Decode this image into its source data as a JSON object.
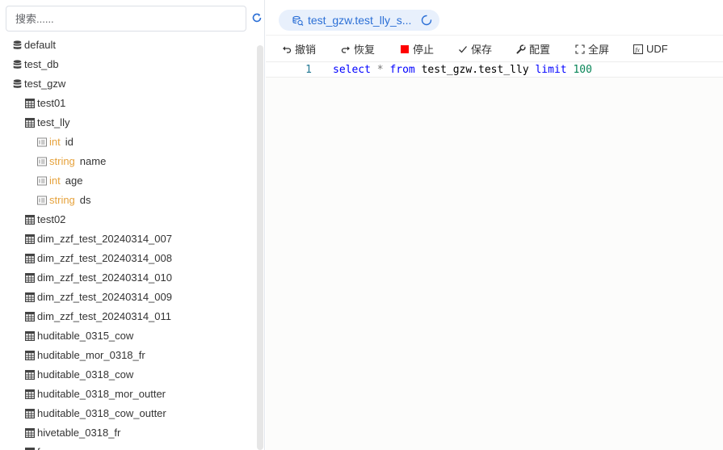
{
  "search": {
    "placeholder": "搜索......"
  },
  "tree": {
    "nodes": [
      {
        "level": 0,
        "kind": "database",
        "label": "default"
      },
      {
        "level": 0,
        "kind": "database",
        "label": "test_db"
      },
      {
        "level": 0,
        "kind": "database",
        "label": "test_gzw"
      },
      {
        "level": 1,
        "kind": "table",
        "label": "test01"
      },
      {
        "level": 1,
        "kind": "table",
        "label": "test_lly"
      },
      {
        "level": 2,
        "kind": "column",
        "type": "int",
        "label": "id"
      },
      {
        "level": 2,
        "kind": "column",
        "type": "string",
        "label": "name"
      },
      {
        "level": 2,
        "kind": "column",
        "type": "int",
        "label": "age"
      },
      {
        "level": 2,
        "kind": "column",
        "type": "string",
        "label": "ds"
      },
      {
        "level": 1,
        "kind": "table",
        "label": "test02"
      },
      {
        "level": 1,
        "kind": "table",
        "label": "dim_zzf_test_20240314_007"
      },
      {
        "level": 1,
        "kind": "table",
        "label": "dim_zzf_test_20240314_008"
      },
      {
        "level": 1,
        "kind": "table",
        "label": "dim_zzf_test_20240314_010"
      },
      {
        "level": 1,
        "kind": "table",
        "label": "dim_zzf_test_20240314_009"
      },
      {
        "level": 1,
        "kind": "table",
        "label": "dim_zzf_test_20240314_011"
      },
      {
        "level": 1,
        "kind": "table",
        "label": "huditable_0315_cow"
      },
      {
        "level": 1,
        "kind": "table",
        "label": "huditable_mor_0318_fr"
      },
      {
        "level": 1,
        "kind": "table",
        "label": "huditable_0318_cow"
      },
      {
        "level": 1,
        "kind": "table",
        "label": "huditable_0318_mor_outter"
      },
      {
        "level": 1,
        "kind": "table",
        "label": "huditable_0318_cow_outter"
      },
      {
        "level": 1,
        "kind": "table",
        "label": "hivetable_0318_fr"
      },
      {
        "level": 1,
        "kind": "table",
        "label": "f..."
      }
    ]
  },
  "tab": {
    "title": "test_gzw.test_lly_s...",
    "icon": "query-icon",
    "status": "loading"
  },
  "toolbar": {
    "undo_label": "撤销",
    "redo_label": "恢复",
    "stop_label": "停止",
    "save_label": "保存",
    "config_label": "配置",
    "fullscreen_label": "全屏",
    "udf_label": "UDF"
  },
  "colors": {
    "accent": "#2b6fd6",
    "type": "#e6a23c",
    "stop": "#ff0000",
    "keyword": "#0000ff",
    "number": "#098658"
  },
  "editor": {
    "line_number": "1",
    "tokens": {
      "t1": "select",
      "t2": " ",
      "t3": "*",
      "t4": " ",
      "t5": "from",
      "t6": " test_gzw.test_lly ",
      "t7": "limit",
      "t8": " ",
      "t9": "100"
    }
  }
}
